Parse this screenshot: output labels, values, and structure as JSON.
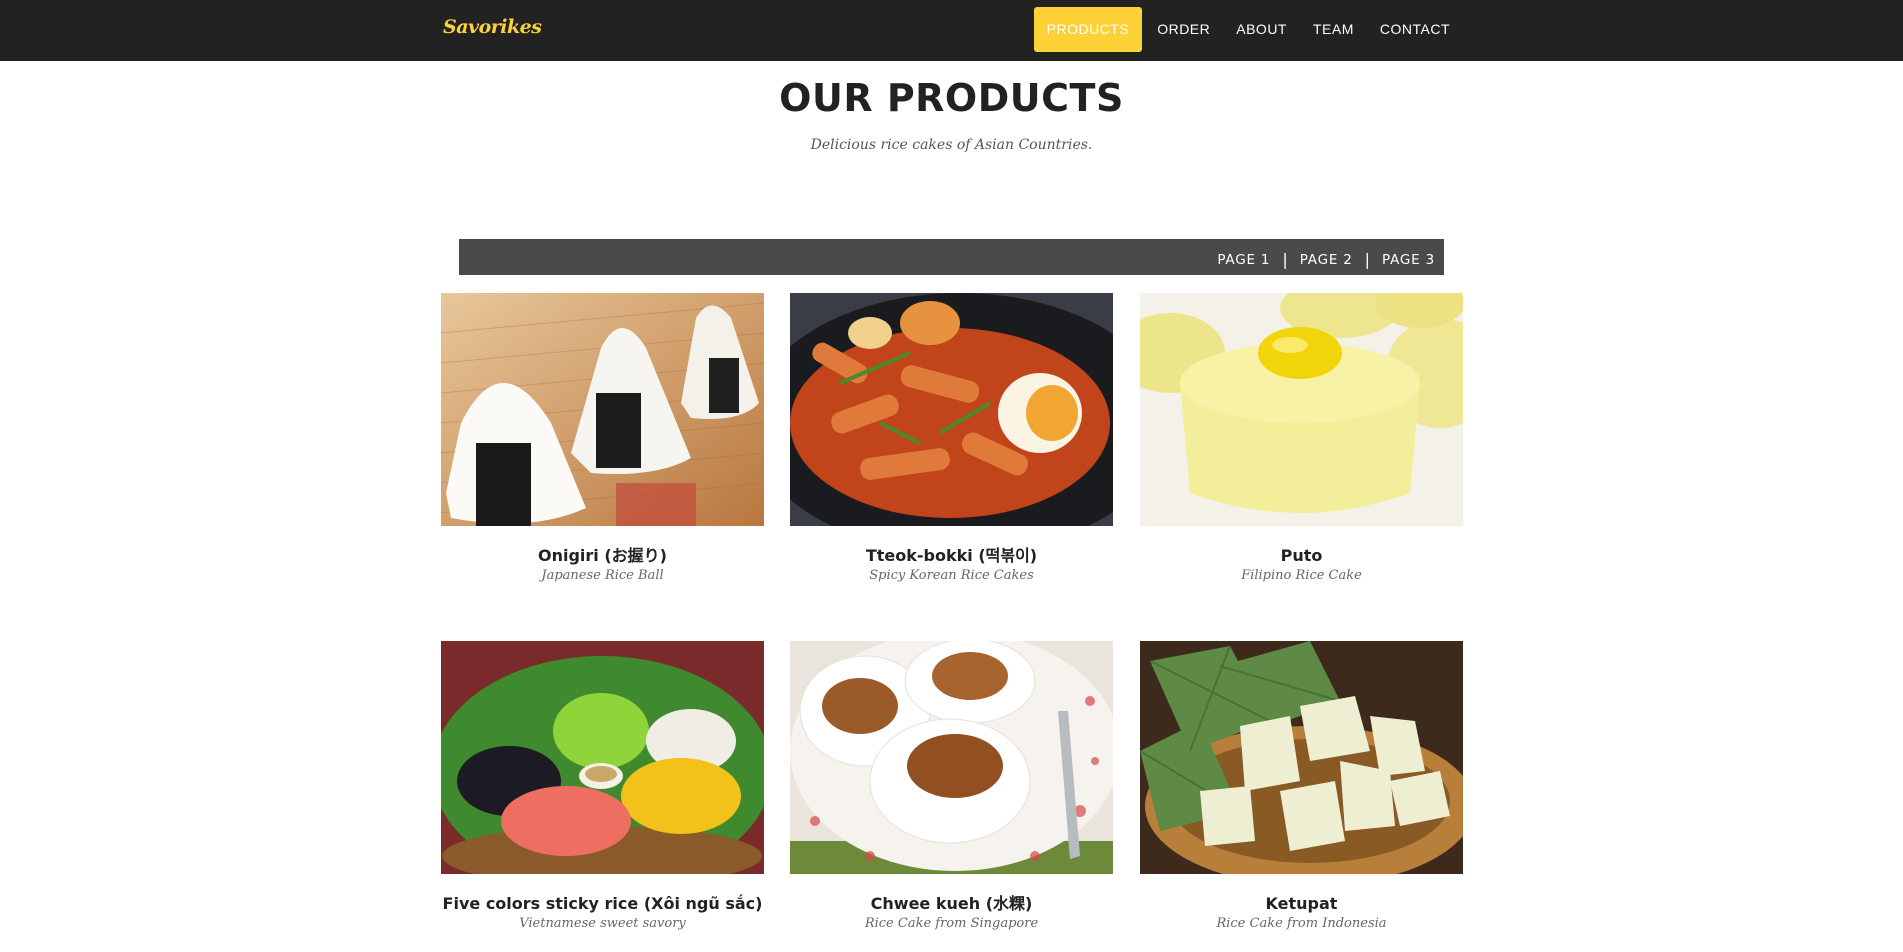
{
  "brand": "Savorikes",
  "nav": [
    "PRODUCTS",
    "ORDER",
    "ABOUT",
    "TEAM",
    "CONTACT"
  ],
  "heading": "OUR PRODUCTS",
  "subheading": "Delicious rice cakes of Asian Countries.",
  "pages": [
    "PAGE 1",
    "PAGE 2",
    "PAGE 3"
  ],
  "colors": {
    "navbar": "#222222",
    "accent": "#fed136",
    "pager": "#4a4a4a"
  },
  "products": [
    {
      "name": "Onigiri (お握り)",
      "desc": "Japanese Rice Ball"
    },
    {
      "name": "Tteok-bokki (떡볶이)",
      "desc": "Spicy Korean Rice Cakes"
    },
    {
      "name": "Puto",
      "desc": "Filipino Rice Cake"
    },
    {
      "name": "Five colors sticky rice (Xôi ngũ sắc)",
      "desc": "Vietnamese sweet savory"
    },
    {
      "name": "Chwee kueh (水粿)",
      "desc": "Rice Cake from Singapore"
    },
    {
      "name": "Ketupat",
      "desc": "Rice Cake from Indonesia"
    }
  ]
}
